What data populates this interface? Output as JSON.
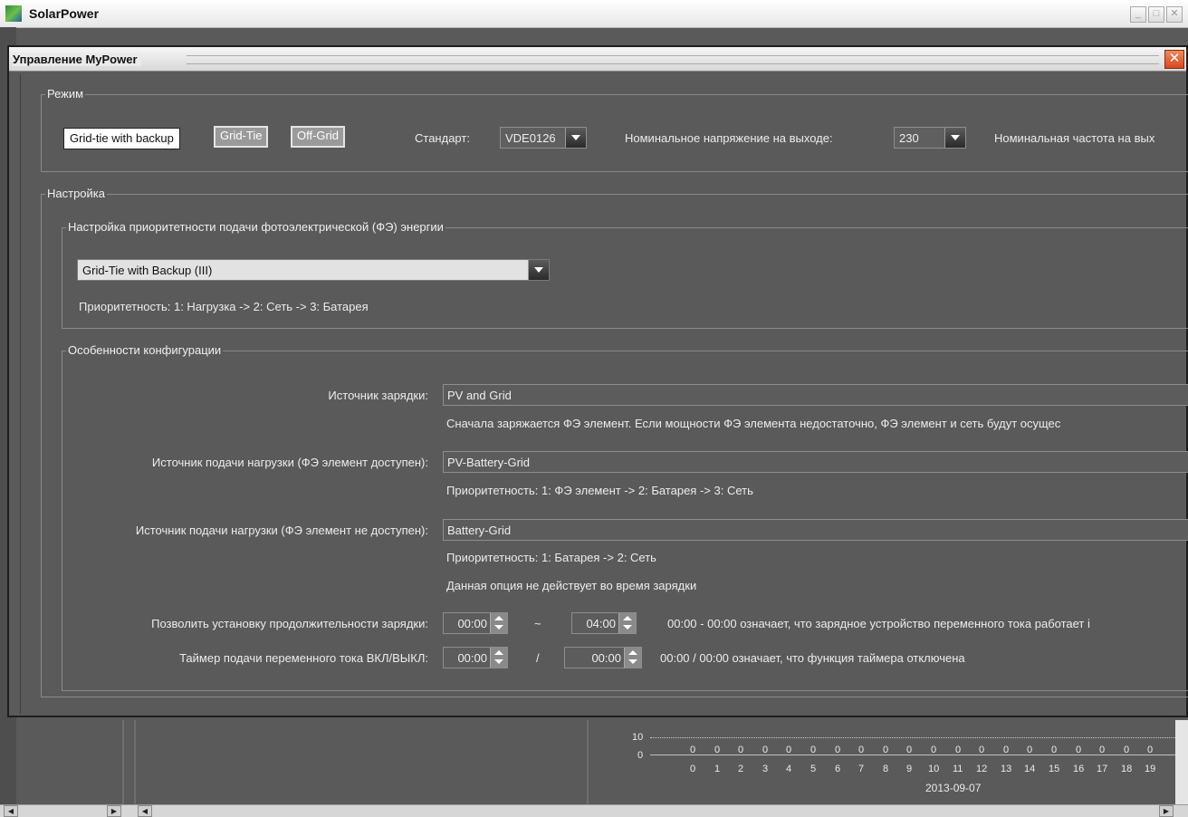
{
  "app": {
    "title": "SolarPower"
  },
  "dialog": {
    "title": "Управление MyPower",
    "close_label": "✕"
  },
  "mode": {
    "legend": "Режим",
    "buttons": [
      "Grid-tie with backup",
      "Grid-Tie",
      "Off-Grid"
    ],
    "standard_label": "Стандарт:",
    "standard_value": "VDE0126",
    "voltage_label": "Номинальное напряжение на выходе:",
    "voltage_value": "230",
    "frequency_label": "Номинальная частота на вых"
  },
  "settings": {
    "legend": "Настройка",
    "priority_group": {
      "legend": "Настройка приоритетности подачи фотоэлектрической (ФЭ) энергии",
      "select_value": "Grid-Tie with Backup (III)",
      "priority_text": "Приоритетность: 1: Нагрузка -> 2: Сеть -> 3: Батарея"
    },
    "config_group": {
      "legend": "Особенности конфигурации",
      "charge_source_label": "Источник зарядки:",
      "charge_source_value": "PV and Grid",
      "charge_source_desc": "Сначала заряжается ФЭ элемент. Если мощности ФЭ элемента недостаточно, ФЭ элемент и сеть будут осущес",
      "load_pv_label": "Источник подачи нагрузки (ФЭ элемент доступен):",
      "load_pv_value": "PV-Battery-Grid",
      "load_pv_desc": "Приоритетность: 1: ФЭ элемент -> 2: Батарея -> 3: Сеть",
      "load_nopv_label": "Источник подачи нагрузки (ФЭ элемент не доступен):",
      "load_nopv_value": "Battery-Grid",
      "load_nopv_desc": "Приоритетность: 1: Батарея -> 2: Сеть",
      "load_nopv_note": "Данная опция не действует во время зарядки",
      "charge_duration_label": "Позволить установку продолжительности зарядки:",
      "charge_start": "00:00",
      "charge_sep": "~",
      "charge_end": "04:00",
      "charge_duration_desc": "00:00 - 00:00 означает, что зарядное устройство переменного тока работает і",
      "ac_timer_label": "Таймер подачи переменного тока ВКЛ/ВЫКЛ:",
      "ac_on": "00:00",
      "ac_sep": "/",
      "ac_off": "00:00",
      "ac_timer_desc": "00:00 / 00:00 означает, что функция таймера отключена"
    }
  },
  "background_chart": {
    "y_ticks": [
      "10",
      "0"
    ],
    "values": [
      "0",
      "0",
      "0",
      "0",
      "0",
      "0",
      "0",
      "0",
      "0",
      "0",
      "0",
      "0",
      "0",
      "0",
      "0",
      "0",
      "0",
      "0",
      "0",
      "0"
    ],
    "x_ticks": [
      "0",
      "1",
      "2",
      "3",
      "4",
      "5",
      "6",
      "7",
      "8",
      "9",
      "10",
      "11",
      "12",
      "13",
      "14",
      "15",
      "16",
      "17",
      "18",
      "19"
    ],
    "date": "2013-09-07"
  }
}
